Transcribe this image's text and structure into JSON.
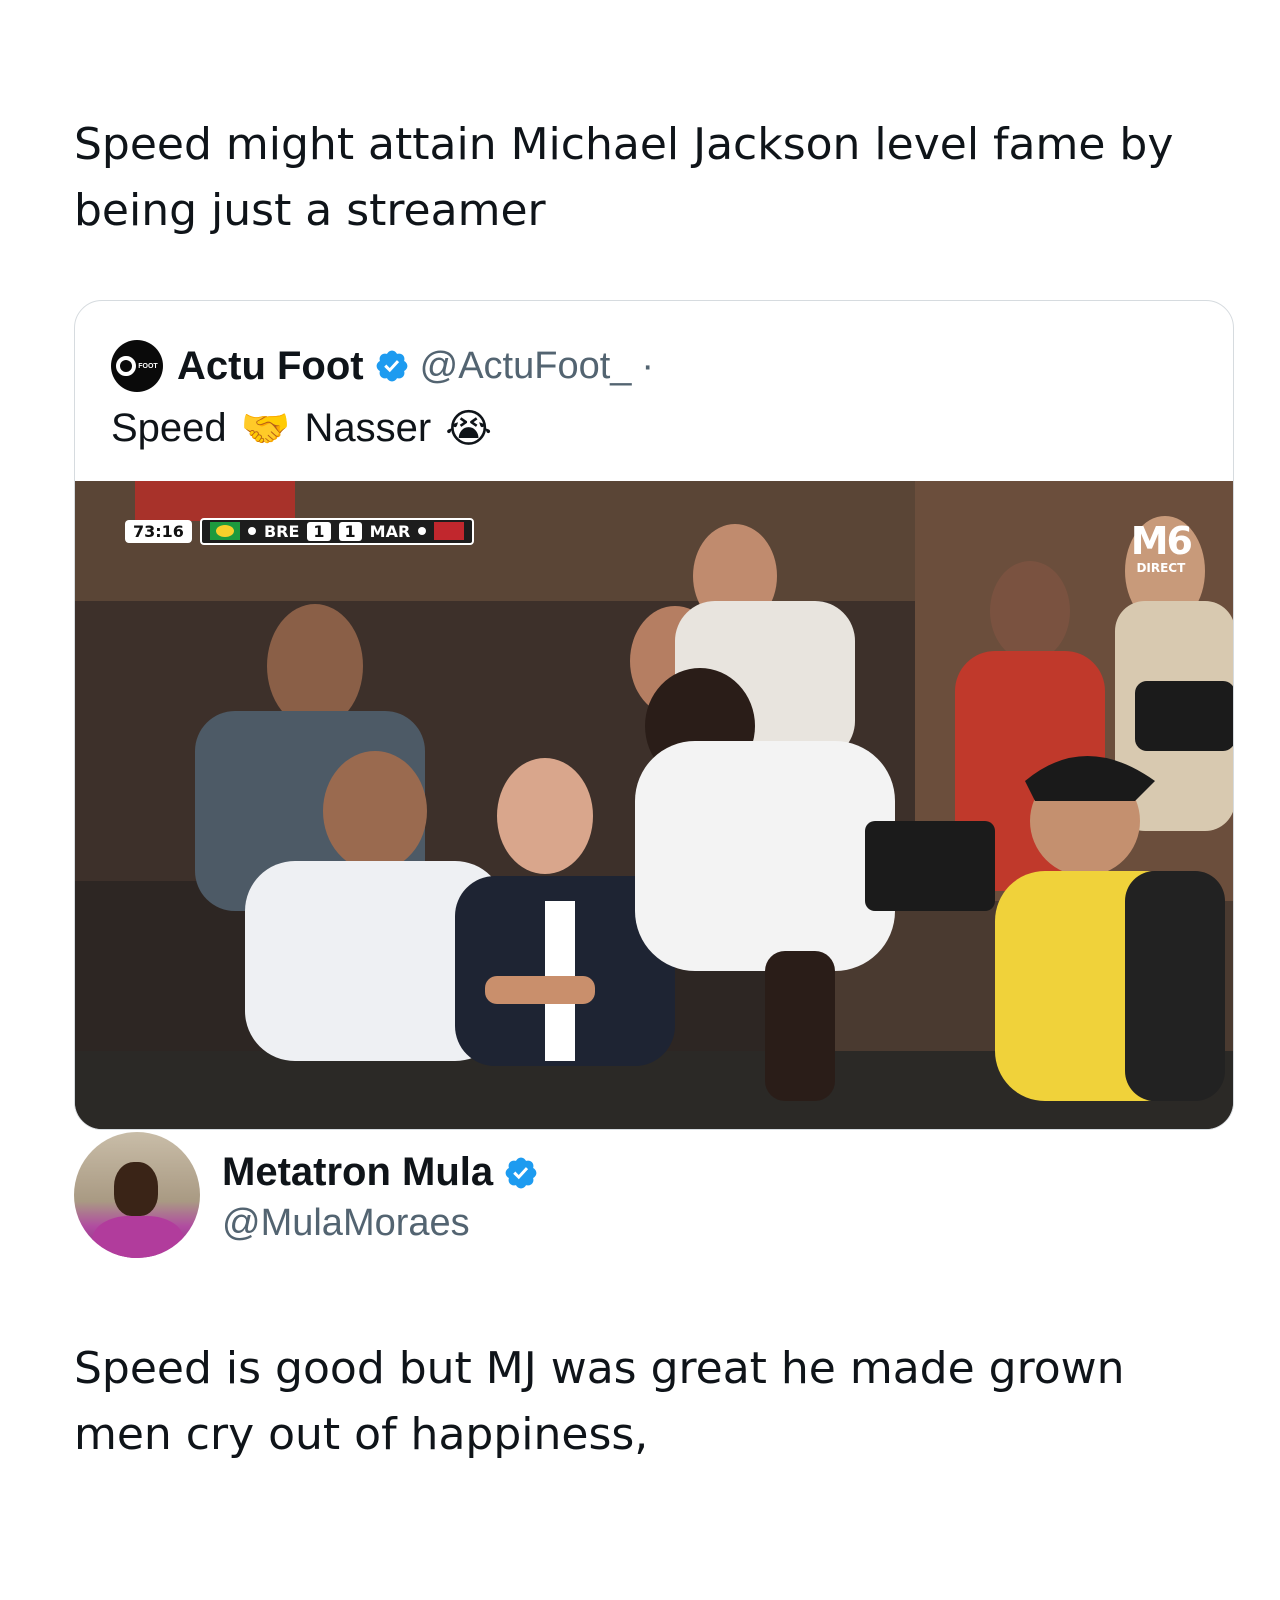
{
  "post": {
    "text": "Speed might attain Michael Jackson level fame by being just a streamer"
  },
  "quoted_tweet": {
    "author_name": "Actu Foot",
    "avatar_text": "FOOT",
    "handle": "@ActuFoot_",
    "separator": "·",
    "text_part1": "Speed",
    "emoji1": "🤝",
    "text_part2": "Nasser",
    "emoji2": "😭",
    "media": {
      "scoreboard": {
        "time": "73:16",
        "team1": "BRE",
        "score1": "1",
        "score2": "1",
        "team2": "MAR"
      },
      "broadcaster": {
        "logo": "M6",
        "label": "DIRECT"
      }
    }
  },
  "reply": {
    "author_name": "Metatron Mula",
    "handle": "@MulaMoraes",
    "text": "Speed is good but MJ was great he made grown men cry out of happiness,"
  },
  "colors": {
    "verified": "#1d9bf0",
    "handle": "#536471",
    "text": "#0f1419",
    "border": "#d6dbdf"
  }
}
